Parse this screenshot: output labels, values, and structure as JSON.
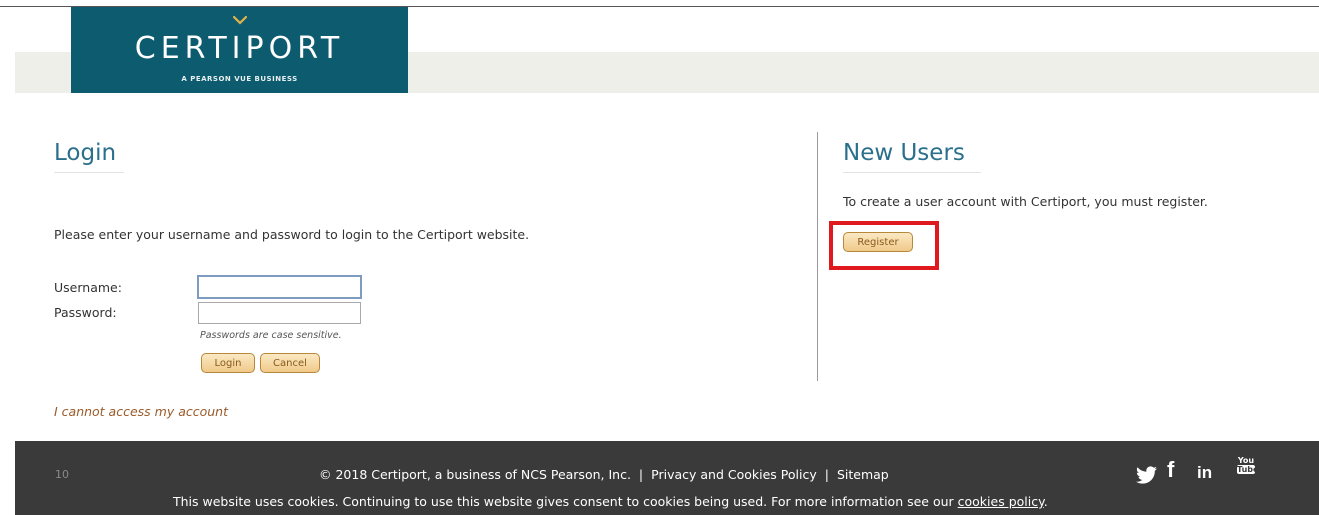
{
  "brand": {
    "wordmark": "CERTIPORT",
    "tagline": "A PEARSON VUE BUSINESS",
    "color": "#0d5b6f"
  },
  "login": {
    "title": "Login",
    "instructions": "Please enter your username and password to login to the Certiport website.",
    "username_label": "Username:",
    "username_value": "",
    "password_label": "Password:",
    "password_value": "",
    "password_note": "Passwords are case sensitive.",
    "login_button": "Login",
    "cancel_button": "Cancel",
    "cannot_access_link": "I cannot access my account"
  },
  "new_users": {
    "title": "New Users",
    "description": "To create a user account with Certiport, you must register.",
    "register_button": "Register",
    "highlight_color": "#e0191e"
  },
  "footer": {
    "page_number": "10",
    "copyright": "© 2018 Certiport, a business of NCS Pearson, Inc.",
    "separator": "|",
    "privacy_link": "Privacy and Cookies Policy",
    "sitemap_link": "Sitemap",
    "cookie_notice": "This website uses cookies. Continuing to use this website gives consent to cookies being used. For more information see our ",
    "cookie_link": "cookies policy",
    "cookie_end": ".",
    "social_icons": [
      "twitter-icon",
      "facebook-icon",
      "linkedin-icon",
      "youtube-icon"
    ],
    "facebook_glyph": "f",
    "linkedin_glyph": "in",
    "youtube_glyph_top": "You",
    "youtube_glyph_bottom": "Tube"
  }
}
